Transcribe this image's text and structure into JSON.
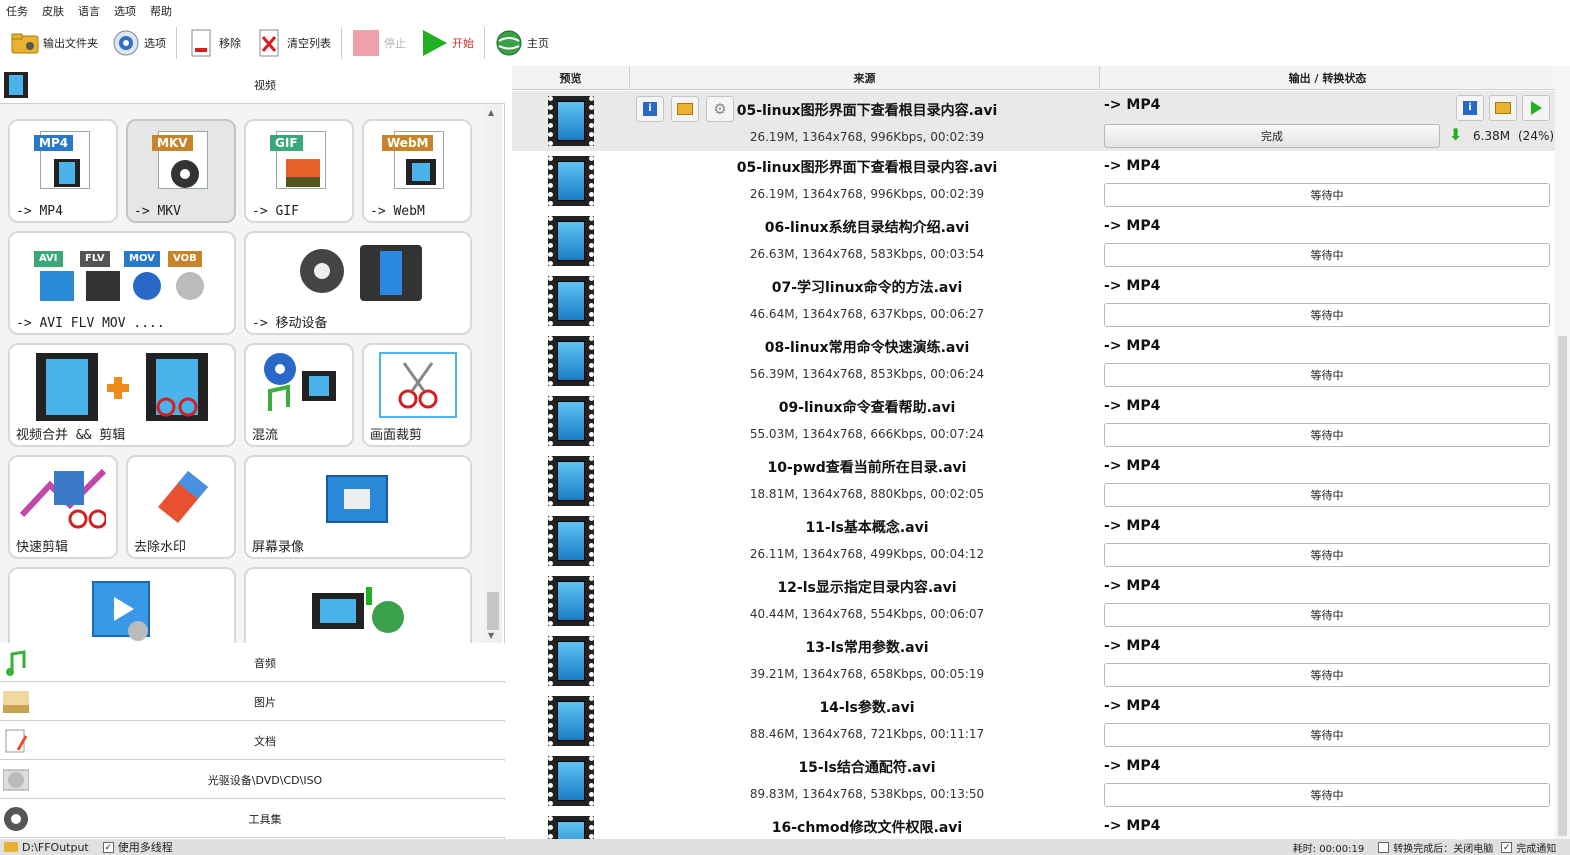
{
  "menu": [
    "任务",
    "皮肤",
    "语言",
    "选项",
    "帮助"
  ],
  "toolbar": {
    "output_folder": "输出文件夹",
    "options": "选项",
    "remove": "移除",
    "clear_list": "清空列表",
    "stop": "停止",
    "start": "开始",
    "home": "主页"
  },
  "left": {
    "video_label": "视频",
    "tiles": {
      "mp4": {
        "badge": "MP4",
        "label": "-> MP4"
      },
      "mkv": {
        "badge": "MKV",
        "label": "-> MKV"
      },
      "gif": {
        "badge": "GIF",
        "label": "-> GIF"
      },
      "webm": {
        "badge": "WebM",
        "label": "-> WebM"
      },
      "multi": {
        "badges": [
          "AVI",
          "FLV",
          "MOV",
          "VOB"
        ],
        "label": "-> AVI FLV MOV ...."
      },
      "mobile": {
        "label": "-> 移动设备"
      },
      "merge": {
        "label": "视频合并 && 剪辑"
      },
      "mix": {
        "label": "混流"
      },
      "crop": {
        "label": "画面裁剪"
      },
      "quickcut": {
        "label": "快速剪辑"
      },
      "watermark": {
        "label": "去除水印"
      },
      "record": {
        "label": "屏幕录像"
      }
    },
    "categories": [
      "音频",
      "图片",
      "文档",
      "光驱设备\\DVD\\CD\\ISO",
      "工具集"
    ]
  },
  "table": {
    "headers": {
      "preview": "预览",
      "source": "来源",
      "output": "输出 / 转换状态"
    },
    "rows": [
      {
        "name": "05-linux图形界面下查看根目录内容.avi",
        "info": "26.19M, 1364x768, 996Kbps, 00:02:39",
        "format": "-> MP4",
        "status": "完成",
        "size": "6.38M",
        "pct": "(24%)"
      },
      {
        "name": "05-linux图形界面下查看根目录内容.avi",
        "info": "26.19M, 1364x768, 996Kbps, 00:02:39",
        "format": "-> MP4",
        "status": "等待中"
      },
      {
        "name": "06-linux系统目录结构介绍.avi",
        "info": "26.63M, 1364x768, 583Kbps, 00:03:54",
        "format": "-> MP4",
        "status": "等待中"
      },
      {
        "name": "07-学习linux命令的方法.avi",
        "info": "46.64M, 1364x768, 637Kbps, 00:06:27",
        "format": "-> MP4",
        "status": "等待中"
      },
      {
        "name": "08-linux常用命令快速演练.avi",
        "info": "56.39M, 1364x768, 853Kbps, 00:06:24",
        "format": "-> MP4",
        "status": "等待中"
      },
      {
        "name": "09-linux命令查看帮助.avi",
        "info": "55.03M, 1364x768, 666Kbps, 00:07:24",
        "format": "-> MP4",
        "status": "等待中"
      },
      {
        "name": "10-pwd查看当前所在目录.avi",
        "info": "18.81M, 1364x768, 880Kbps, 00:02:05",
        "format": "-> MP4",
        "status": "等待中"
      },
      {
        "name": "11-ls基本概念.avi",
        "info": "26.11M, 1364x768, 499Kbps, 00:04:12",
        "format": "-> MP4",
        "status": "等待中"
      },
      {
        "name": "12-ls显示指定目录内容.avi",
        "info": "40.44M, 1364x768, 554Kbps, 00:06:07",
        "format": "-> MP4",
        "status": "等待中"
      },
      {
        "name": "13-ls常用参数.avi",
        "info": "39.21M, 1364x768, 658Kbps, 00:05:19",
        "format": "-> MP4",
        "status": "等待中"
      },
      {
        "name": "14-ls参数.avi",
        "info": "88.46M, 1364x768, 721Kbps, 00:11:17",
        "format": "-> MP4",
        "status": "等待中"
      },
      {
        "name": "15-ls结合通配符.avi",
        "info": "89.83M, 1364x768, 538Kbps, 00:13:50",
        "format": "-> MP4",
        "status": "等待中"
      },
      {
        "name": "16-chmod修改文件权限.avi",
        "info": "",
        "format": "-> MP4",
        "status": ""
      }
    ]
  },
  "status": {
    "path": "D:\\FFOutput",
    "multithread": "使用多线程",
    "elapsed": "耗时: 00:00:19",
    "after": "转换完成后：关闭电脑",
    "notify": "完成通知"
  },
  "watermark": "https://blog.csdn.net/weixin_44754697"
}
